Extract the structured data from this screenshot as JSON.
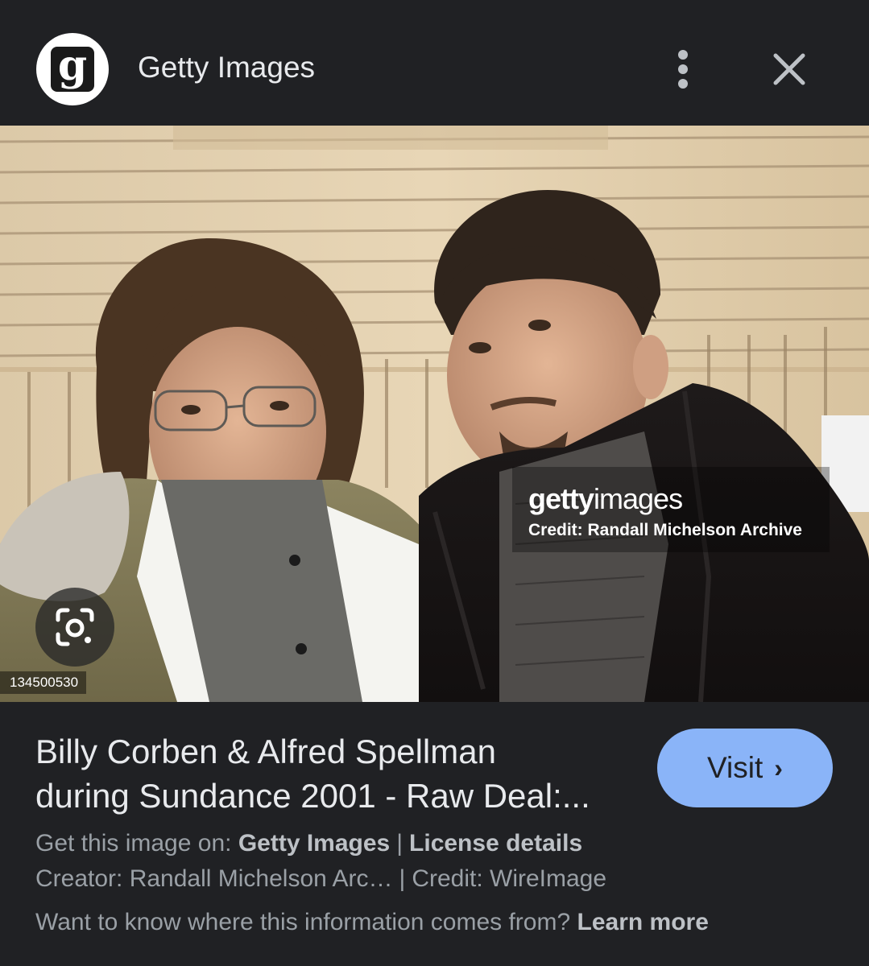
{
  "header": {
    "logo_letter": "g",
    "site_name": "Getty Images",
    "icons": {
      "more": "more-vert-icon",
      "close": "close-icon"
    }
  },
  "photo": {
    "watermark_brand_bold": "getty",
    "watermark_brand_rest": "images",
    "watermark_credit": "Credit: Randall Michelson Archive",
    "image_id": "134500530",
    "lens_icon": "google-lens-icon"
  },
  "info": {
    "title_line1": "Billy Corben & Alfred Spellman",
    "title_line2": "during Sundance 2001 - Raw Deal:...",
    "visit_label": "Visit",
    "visit_chevron": "›",
    "source_prefix": "Get this image on:",
    "source_name": "Getty Images",
    "separator": "|",
    "license_link": "License details",
    "creator_text": "Creator: Randall Michelson Arc…",
    "credit_text": "Credit: WireImage",
    "info_question": "Want to know where this information comes from?",
    "learn_more": "Learn more"
  },
  "colors": {
    "background": "#202124",
    "accent": "#8ab4f8",
    "primary_text": "#e8eaed",
    "secondary_text": "#9aa0a6"
  }
}
